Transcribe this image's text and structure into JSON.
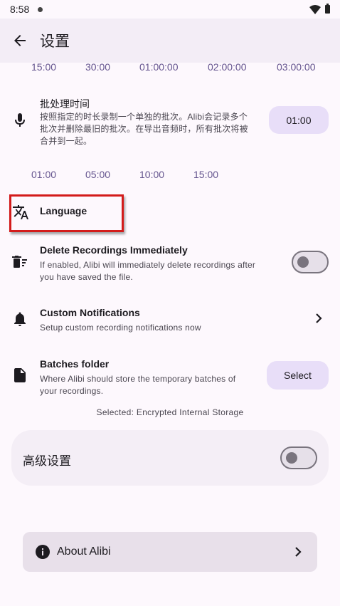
{
  "status_bar": {
    "time": "8:58"
  },
  "app_bar": {
    "title": "设置"
  },
  "max_duration_options": [
    "15:00",
    "30:00",
    "01:00:00",
    "02:00:00",
    "03:00:00"
  ],
  "batch_time": {
    "title": "批处理时间",
    "description_line1": "按照指定的时长录制一个单独的批次。Alibi会记录多个",
    "description_line2": "批次并删除最旧的批次。在导出音频时，所有批次将被",
    "description_line3": "合并到一起。",
    "button_label": "01:00",
    "options": [
      "01:00",
      "05:00",
      "10:00",
      "15:00"
    ]
  },
  "language": {
    "title": "Language"
  },
  "delete_recordings": {
    "title": "Delete Recordings Immediately",
    "description_line1": "If enabled, Alibi will immediately delete recordings after",
    "description_line2": "you have saved the file."
  },
  "custom_notifications": {
    "title": "Custom Notifications",
    "description": "Setup custom recording notifications now"
  },
  "batches_folder": {
    "title": "Batches folder",
    "description_line1": "Where Alibi should store the temporary batches of",
    "description_line2": "your recordings.",
    "button_label": "Select",
    "selected_text": "Selected: Encrypted Internal Storage"
  },
  "advanced": {
    "label": "高级设置"
  },
  "about": {
    "label": "About Alibi"
  },
  "colors": {
    "accent": "#65558f",
    "highlight": "#d31b1b",
    "surface": "#fdf8fd"
  }
}
